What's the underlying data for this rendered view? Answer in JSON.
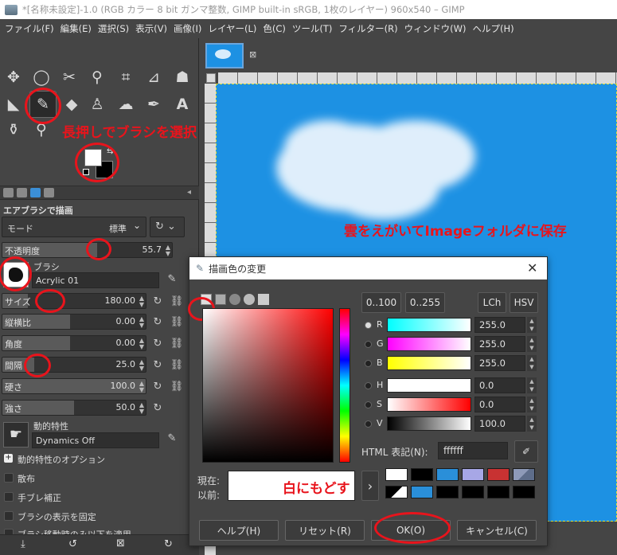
{
  "window": {
    "title": "*[名称未設定]-1.0 (RGB カラー 8 bit ガンマ整数, GIMP built-in sRGB, 1枚のレイヤー) 960x540 – GIMP"
  },
  "menu": [
    "ファイル(F)",
    "編集(E)",
    "選択(S)",
    "表示(V)",
    "画像(I)",
    "レイヤー(L)",
    "色(C)",
    "ツール(T)",
    "フィルター(R)",
    "ウィンドウ(W)",
    "ヘルプ(H)"
  ],
  "annotations": {
    "brush_hint": "長押しでブラシを選択",
    "canvas_hint": "雲をえがいてImageフォルダに保存",
    "white_hint": "白にもどす"
  },
  "tool_options": {
    "title": "エアブラシで描画",
    "mode_label": "モード",
    "mode_value": "標準",
    "opacity_label": "不透明度",
    "opacity_value": "55.7",
    "opacity_fraction": 0.557,
    "brush_label": "ブラシ",
    "brush_name": "Acrylic 01",
    "size_label": "サイズ",
    "size_value": "180.00",
    "aspect_label": "縦横比",
    "aspect_value": "0.00",
    "angle_label": "角度",
    "angle_value": "0.00",
    "spacing_label": "間隔",
    "spacing_value": "25.0",
    "hardness_label": "硬さ",
    "hardness_value": "100.0",
    "force_label": "強さ",
    "force_value": "50.0",
    "dynamics_label": "動的特性",
    "dynamics_value": "Dynamics Off",
    "dyn_options_label": "動的特性のオプション",
    "scatter_label": "散布",
    "stabilize_label": "手ブレ補正",
    "lock_brush_label": "ブラシの表示を固定",
    "last_label": "ブラシ移動時のみ以下を適用"
  },
  "dialog": {
    "title": "描画色の変更",
    "range_01": "0..100",
    "range_0255": "0..255",
    "lch": "LCh",
    "hsv": "HSV",
    "channels": [
      {
        "name": "R",
        "value": "255.0"
      },
      {
        "name": "G",
        "value": "255.0"
      },
      {
        "name": "B",
        "value": "255.0"
      },
      {
        "name": "H",
        "value": "0.0"
      },
      {
        "name": "S",
        "value": "0.0"
      },
      {
        "name": "V",
        "value": "100.0"
      }
    ],
    "html_label": "HTML 表記(N):",
    "html_value": "ffffff",
    "current_label": "現在:",
    "previous_label": "以前:",
    "help_btn": "ヘルプ(H)",
    "reset_btn": "リセット(R)",
    "ok_btn": "OK(O)",
    "cancel_btn": "キャンセル(C)",
    "history": [
      "#ffffff",
      "#000000",
      "#2a8fd9",
      "#a7a7e6",
      "#c83232",
      "#8e9ab8",
      "#ffffff",
      "#2a8fd9",
      "#000000",
      "#000000",
      "#000000",
      "#000000"
    ],
    "arrow": "›"
  },
  "colors": {
    "red": "#e8141c",
    "canvas_blue": "#1d91e3"
  }
}
